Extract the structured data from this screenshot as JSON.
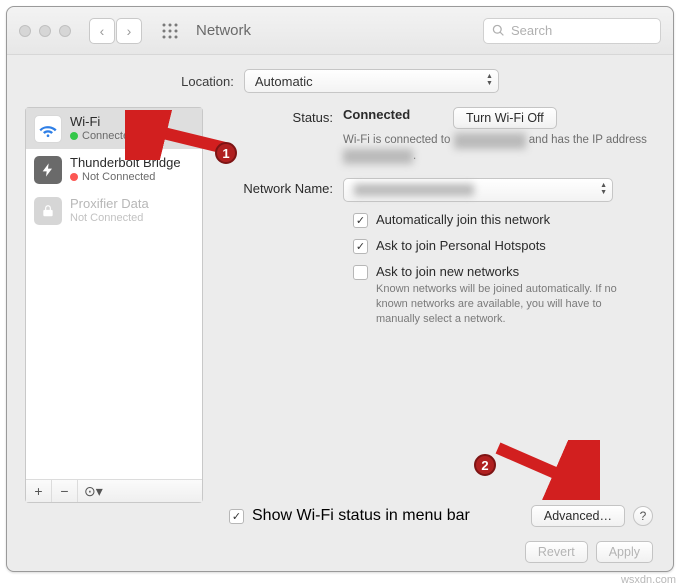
{
  "toolbar": {
    "title": "Network",
    "search_placeholder": "Search"
  },
  "location": {
    "label": "Location:",
    "value": "Automatic"
  },
  "sidebar": {
    "services": [
      {
        "name": "Wi-Fi",
        "status": "Connected",
        "dot": "green",
        "selected": true,
        "disabled": false,
        "icon": "wifi"
      },
      {
        "name": "Thunderbolt Bridge",
        "status": "Not Connected",
        "dot": "red",
        "selected": false,
        "disabled": false,
        "icon": "thunderbolt"
      },
      {
        "name": "Proxifier Data",
        "status": "Not Connected",
        "dot": "gray",
        "selected": false,
        "disabled": true,
        "icon": "lock"
      }
    ],
    "footer_buttons": [
      "+",
      "−",
      "⊙▾"
    ]
  },
  "detail": {
    "status_label": "Status:",
    "status_value": "Connected",
    "wifi_off_btn": "Turn Wi-Fi Off",
    "status_desc_pre": "Wi-Fi is connected to ",
    "status_desc_mid": " and has the IP address ",
    "status_desc_end": ".",
    "network_name_label": "Network Name:",
    "network_name_value": "██████████",
    "checkboxes": [
      {
        "label": "Automatically join this network",
        "checked": true
      },
      {
        "label": "Ask to join Personal Hotspots",
        "checked": true
      },
      {
        "label": "Ask to join new networks",
        "checked": false
      }
    ],
    "join_hint": "Known networks will be joined automatically. If no known networks are available, you will have to manually select a network."
  },
  "bottom": {
    "show_status_label": "Show Wi-Fi status in menu bar",
    "show_status_checked": true,
    "advanced_btn": "Advanced…",
    "help": "?"
  },
  "footer": {
    "revert": "Revert",
    "apply": "Apply"
  },
  "annotations": {
    "1": "1",
    "2": "2"
  },
  "watermark": "wsxdn.com"
}
